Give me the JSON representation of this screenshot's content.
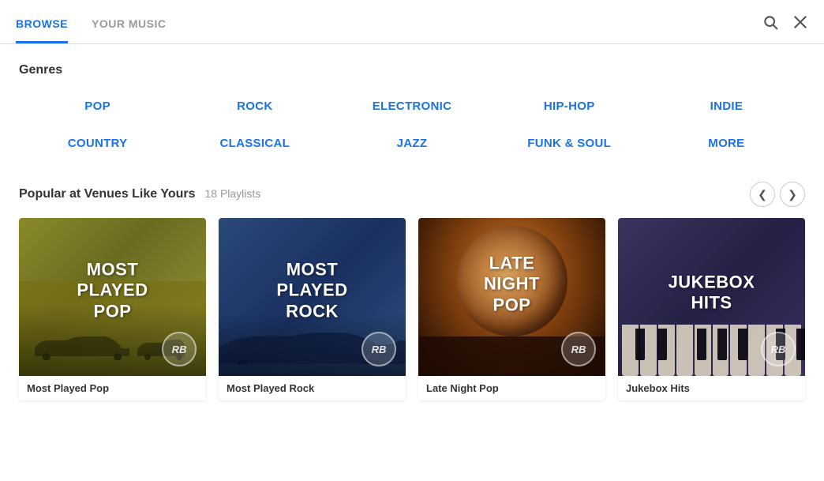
{
  "nav": {
    "tabs": [
      {
        "id": "browse",
        "label": "BROWSE",
        "active": true
      },
      {
        "id": "your-music",
        "label": "YOUR MUSIC",
        "active": false
      }
    ],
    "search_icon": "search",
    "close_icon": "close"
  },
  "genres": {
    "section_title": "Genres",
    "items": [
      {
        "id": "pop",
        "label": "POP"
      },
      {
        "id": "rock",
        "label": "ROCK"
      },
      {
        "id": "electronic",
        "label": "ELECTRONIC"
      },
      {
        "id": "hip-hop",
        "label": "HIP-HOP"
      },
      {
        "id": "indie",
        "label": "INDIE"
      },
      {
        "id": "country",
        "label": "COUNTRY"
      },
      {
        "id": "classical",
        "label": "CLASSICAL"
      },
      {
        "id": "jazz",
        "label": "JAZZ"
      },
      {
        "id": "funk-soul",
        "label": "FUNK & SOUL"
      },
      {
        "id": "more",
        "label": "MORE"
      }
    ]
  },
  "popular": {
    "section_title": "Popular at Venues Like Yours",
    "count_label": "18 Playlists",
    "playlists": [
      {
        "id": "most-played-pop",
        "thumbnail_label": "MOST PLAYED POP",
        "name": "Most Played Pop",
        "bg_class": "card-1-bg"
      },
      {
        "id": "most-played-rock",
        "thumbnail_label": "MOST PLAYED ROCK",
        "name": "Most Played Rock",
        "bg_class": "card-2-bg"
      },
      {
        "id": "late-night-pop",
        "thumbnail_label": "LATE NIGHT POP",
        "name": "Late Night Pop",
        "bg_class": "card-3-bg"
      },
      {
        "id": "jukebox-hits",
        "thumbnail_label": "JUKEBOX HITS",
        "name": "Jukebox Hits",
        "bg_class": "card-4-bg"
      }
    ],
    "prev_arrow": "❮",
    "next_arrow": "❯"
  }
}
